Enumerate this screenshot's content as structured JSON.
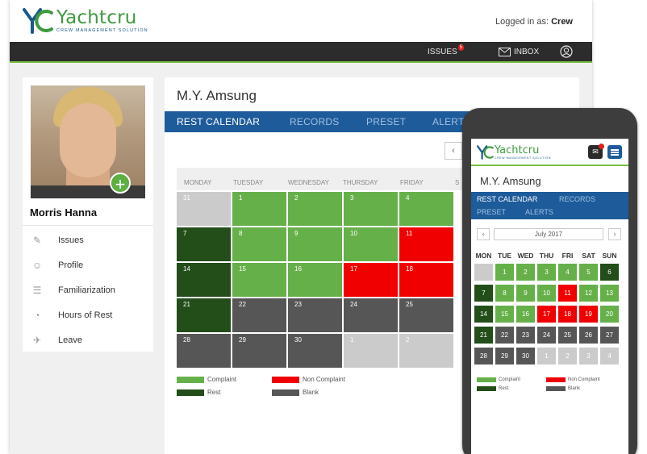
{
  "app": {
    "logo_name": "Yachtcru",
    "logo_subtitle": "CREW MANAGEMENT SOLUTION",
    "logged_in_label": "Logged in as:",
    "logged_in_user": "Crew"
  },
  "nav": {
    "issues_label": "ISSUES",
    "issues_badge": "5",
    "inbox_label": "INBOX"
  },
  "profile": {
    "name": "Morris Hanna",
    "menu": [
      {
        "label": "Issues",
        "icon": "pen-icon"
      },
      {
        "label": "Profile",
        "icon": "person-icon"
      },
      {
        "label": "Familiarization",
        "icon": "list-icon"
      },
      {
        "label": "Hours of Rest",
        "icon": "clock-icon"
      },
      {
        "label": "Leave",
        "icon": "plane-icon"
      }
    ]
  },
  "main": {
    "vessel": "M.Y. Amsung",
    "tabs": [
      "REST CALENDAR",
      "RECORDS",
      "PRESET",
      "ALERTS"
    ],
    "prev_label": "‹",
    "day_headers": [
      "MONDAY",
      "TUESDAY",
      "WEDNESDAY",
      "THURSDAY",
      "FRIDAY",
      "S"
    ],
    "weeks": [
      [
        {
          "d": "31",
          "s": "out"
        },
        {
          "d": "1",
          "s": "complaint"
        },
        {
          "d": "2",
          "s": "complaint"
        },
        {
          "d": "3",
          "s": "complaint"
        },
        {
          "d": "4",
          "s": "complaint"
        }
      ],
      [
        {
          "d": "7",
          "s": "rest"
        },
        {
          "d": "8",
          "s": "complaint"
        },
        {
          "d": "9",
          "s": "complaint"
        },
        {
          "d": "10",
          "s": "complaint"
        },
        {
          "d": "11",
          "s": "non"
        }
      ],
      [
        {
          "d": "14",
          "s": "rest"
        },
        {
          "d": "15",
          "s": "complaint"
        },
        {
          "d": "16",
          "s": "complaint"
        },
        {
          "d": "17",
          "s": "non"
        },
        {
          "d": "18",
          "s": "non"
        }
      ],
      [
        {
          "d": "21",
          "s": "rest"
        },
        {
          "d": "22",
          "s": "blank"
        },
        {
          "d": "23",
          "s": "blank"
        },
        {
          "d": "24",
          "s": "blank"
        },
        {
          "d": "25",
          "s": "blank"
        }
      ],
      [
        {
          "d": "28",
          "s": "blank"
        },
        {
          "d": "29",
          "s": "blank"
        },
        {
          "d": "30",
          "s": "blank"
        },
        {
          "d": "1",
          "s": "out"
        },
        {
          "d": "2",
          "s": "out"
        }
      ]
    ]
  },
  "legend": {
    "complaint": "Complaint",
    "non_complaint": "Non Complaint",
    "rest": "Rest",
    "blank": "Blank"
  },
  "colors": {
    "complaint": "#66b04a",
    "rest": "#234d19",
    "non": "#f00000",
    "blank": "#565656",
    "out": "#cbcbcb",
    "brand_blue": "#1e5b9a",
    "brand_green": "#3d9a3f"
  },
  "phone": {
    "vessel": "M.Y. Amsung",
    "tabs": [
      "REST CALENDAR",
      "RECORDS",
      "PRESET",
      "ALERTS"
    ],
    "month_label": "July  2017",
    "prev_label": "‹",
    "next_label": "›",
    "day_headers": [
      "MON",
      "TUE",
      "WED",
      "THU",
      "FRI",
      "SAT",
      "SUN"
    ],
    "weeks": [
      [
        {
          "d": "",
          "s": "out"
        },
        {
          "d": "1",
          "s": "complaint"
        },
        {
          "d": "2",
          "s": "complaint"
        },
        {
          "d": "3",
          "s": "complaint"
        },
        {
          "d": "4",
          "s": "complaint"
        },
        {
          "d": "5",
          "s": "complaint"
        },
        {
          "d": "6",
          "s": "rest"
        }
      ],
      [
        {
          "d": "7",
          "s": "rest"
        },
        {
          "d": "8",
          "s": "complaint"
        },
        {
          "d": "9",
          "s": "complaint"
        },
        {
          "d": "10",
          "s": "complaint"
        },
        {
          "d": "11",
          "s": "non"
        },
        {
          "d": "12",
          "s": "complaint"
        },
        {
          "d": "13",
          "s": "complaint"
        }
      ],
      [
        {
          "d": "14",
          "s": "rest"
        },
        {
          "d": "15",
          "s": "complaint"
        },
        {
          "d": "16",
          "s": "complaint"
        },
        {
          "d": "17",
          "s": "non"
        },
        {
          "d": "18",
          "s": "non"
        },
        {
          "d": "19",
          "s": "non"
        },
        {
          "d": "20",
          "s": "complaint"
        }
      ],
      [
        {
          "d": "21",
          "s": "rest"
        },
        {
          "d": "22",
          "s": "blank"
        },
        {
          "d": "23",
          "s": "blank"
        },
        {
          "d": "24",
          "s": "blank"
        },
        {
          "d": "25",
          "s": "blank"
        },
        {
          "d": "26",
          "s": "blank"
        },
        {
          "d": "27",
          "s": "blank"
        }
      ],
      [
        {
          "d": "28",
          "s": "blank"
        },
        {
          "d": "29",
          "s": "blank"
        },
        {
          "d": "30",
          "s": "blank"
        },
        {
          "d": "1",
          "s": "out"
        },
        {
          "d": "2",
          "s": "out"
        },
        {
          "d": "3",
          "s": "out"
        },
        {
          "d": "4",
          "s": "out"
        }
      ]
    ]
  }
}
